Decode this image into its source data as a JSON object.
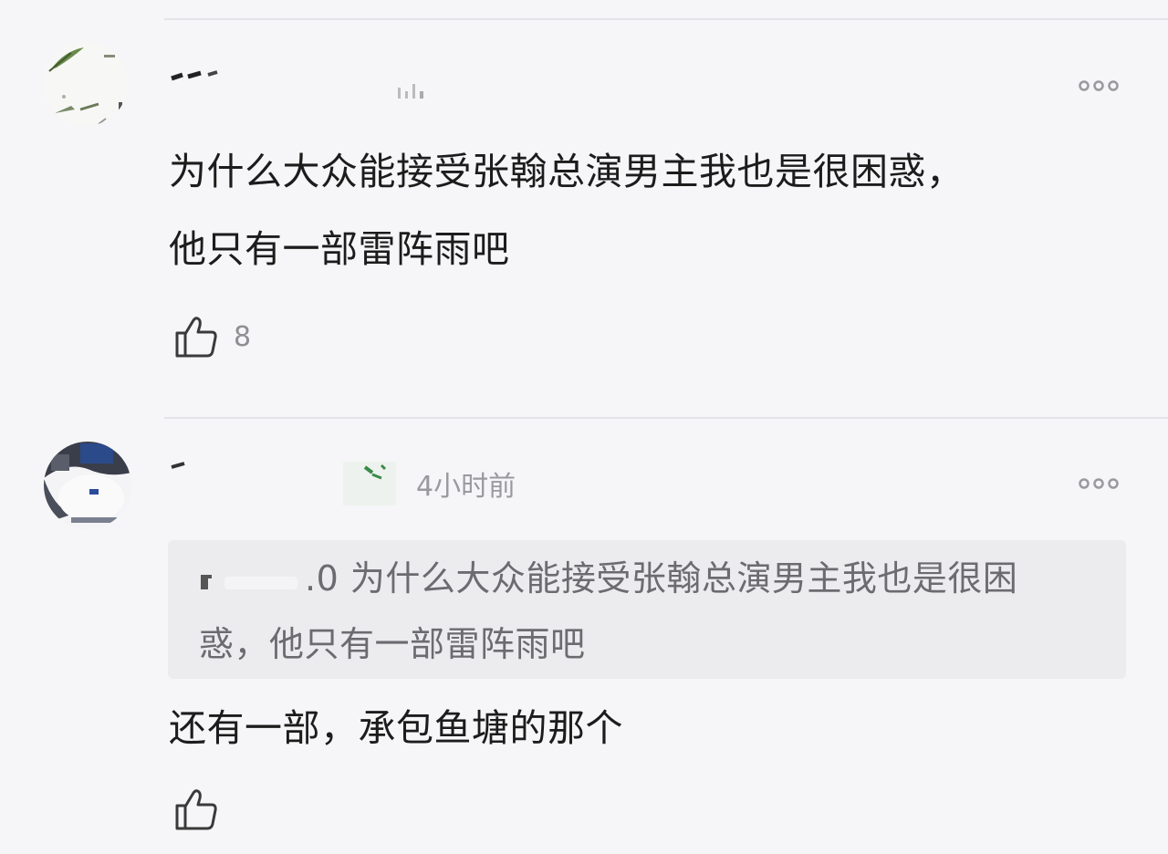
{
  "comments": [
    {
      "avatar_icon": "user-avatar-icon",
      "username": "",
      "timestamp": "",
      "more_icon": "more-options-icon",
      "text_lines": [
        "为什么大众能接受张翰总演男主我也是很困惑，",
        "他只有一部雷阵雨吧"
      ],
      "like_icon": "thumbs-up-icon",
      "like_count": "8"
    },
    {
      "avatar_icon": "user-avatar-icon",
      "username": "",
      "timestamp": "4小时前",
      "more_icon": "more-options-icon",
      "quoted": {
        "author_suffix": ".0",
        "text_lines": [
          "为什么大众能接受张翰总演男主我也是很困",
          "惑，他只有一部雷阵雨吧"
        ]
      },
      "text_lines": [
        "还有一部，承包鱼塘的那个"
      ],
      "like_icon": "thumbs-up-icon",
      "like_count": ""
    }
  ]
}
